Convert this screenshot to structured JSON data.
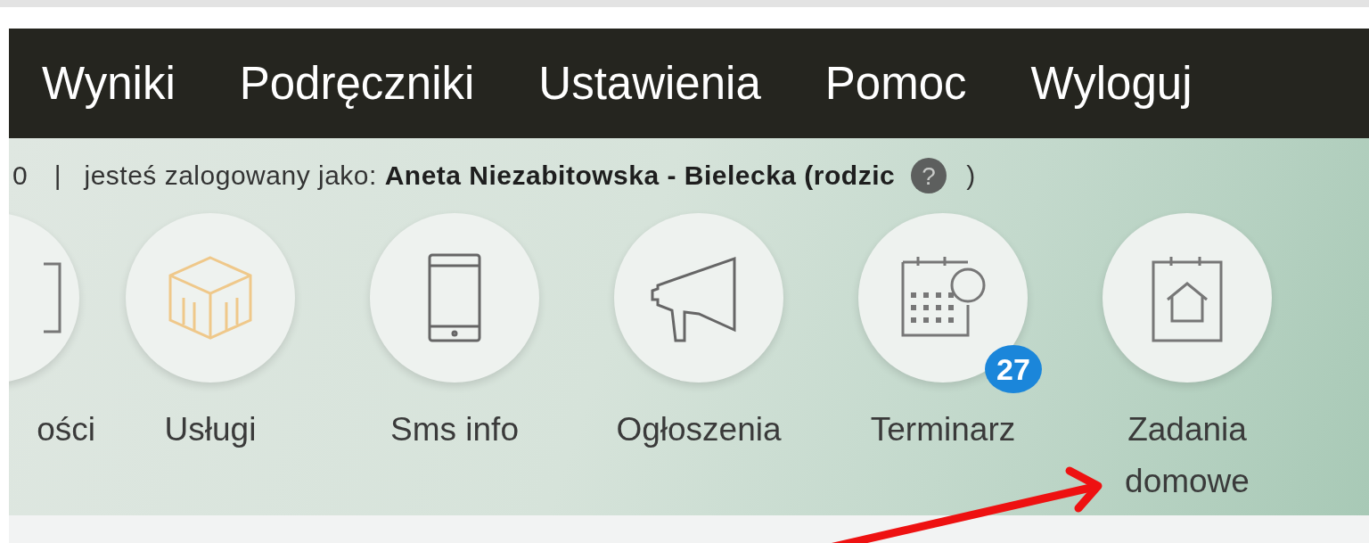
{
  "nav": {
    "items": [
      {
        "label": "Wyniki"
      },
      {
        "label": "Podręczniki"
      },
      {
        "label": "Ustawienia"
      },
      {
        "label": "Pomoc"
      },
      {
        "label": "Wyloguj"
      }
    ]
  },
  "info_bar": {
    "counter": "0",
    "separator": "|",
    "login_text": "jesteś zalogowany jako: **Aneta Niezabitowska - Bielecka (rodzic**",
    "help_label": "?",
    "closing": ")"
  },
  "modules": [
    {
      "label": "ości"
    },
    {
      "label": "Usługi"
    },
    {
      "label": "Sms info"
    },
    {
      "label": "Ogłoszenia"
    },
    {
      "label": "Terminarz",
      "badge": "27"
    },
    {
      "label": "Zadania domowe"
    }
  ]
}
